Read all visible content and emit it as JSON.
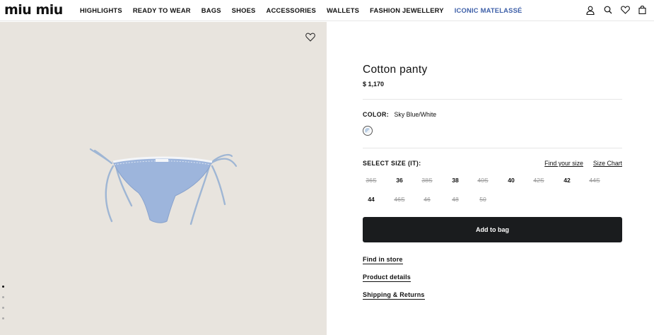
{
  "header": {
    "logo": "miu miu",
    "nav": [
      "HIGHLIGHTS",
      "READY TO WEAR",
      "BAGS",
      "SHOES",
      "ACCESSORIES",
      "WALLETS",
      "FASHION JEWELLERY",
      "ICONIC MATELASSÉ"
    ],
    "accent_color": "#3d5fa8",
    "icons": [
      "account-icon",
      "search-icon",
      "wishlist-icon",
      "bag-icon"
    ]
  },
  "gallery": {
    "background": "#e8e4de",
    "image": "light blue cotton tie-side bikini panty",
    "dot_count": 4,
    "active_dot": 0
  },
  "product": {
    "title": "Cotton panty",
    "price": "$ 1,170",
    "color_label": "COLOR:",
    "color_value": "Sky Blue/White",
    "size_label": "SELECT SIZE (IT):",
    "find_size": "Find your size",
    "size_chart": "Size Chart",
    "sizes": [
      {
        "label": "36S",
        "available": false
      },
      {
        "label": "36",
        "available": true
      },
      {
        "label": "38S",
        "available": false
      },
      {
        "label": "38",
        "available": true
      },
      {
        "label": "40S",
        "available": false
      },
      {
        "label": "40",
        "available": true
      },
      {
        "label": "42S",
        "available": false
      },
      {
        "label": "42",
        "available": true
      },
      {
        "label": "44S",
        "available": false
      },
      {
        "label": "44",
        "available": true
      },
      {
        "label": "46S",
        "available": false
      },
      {
        "label": "46",
        "available": false
      },
      {
        "label": "48",
        "available": false
      },
      {
        "label": "50",
        "available": false
      }
    ],
    "add_to_bag": "Add to bag",
    "links": [
      "Find in store",
      "Product details",
      "Shipping & Returns"
    ]
  }
}
